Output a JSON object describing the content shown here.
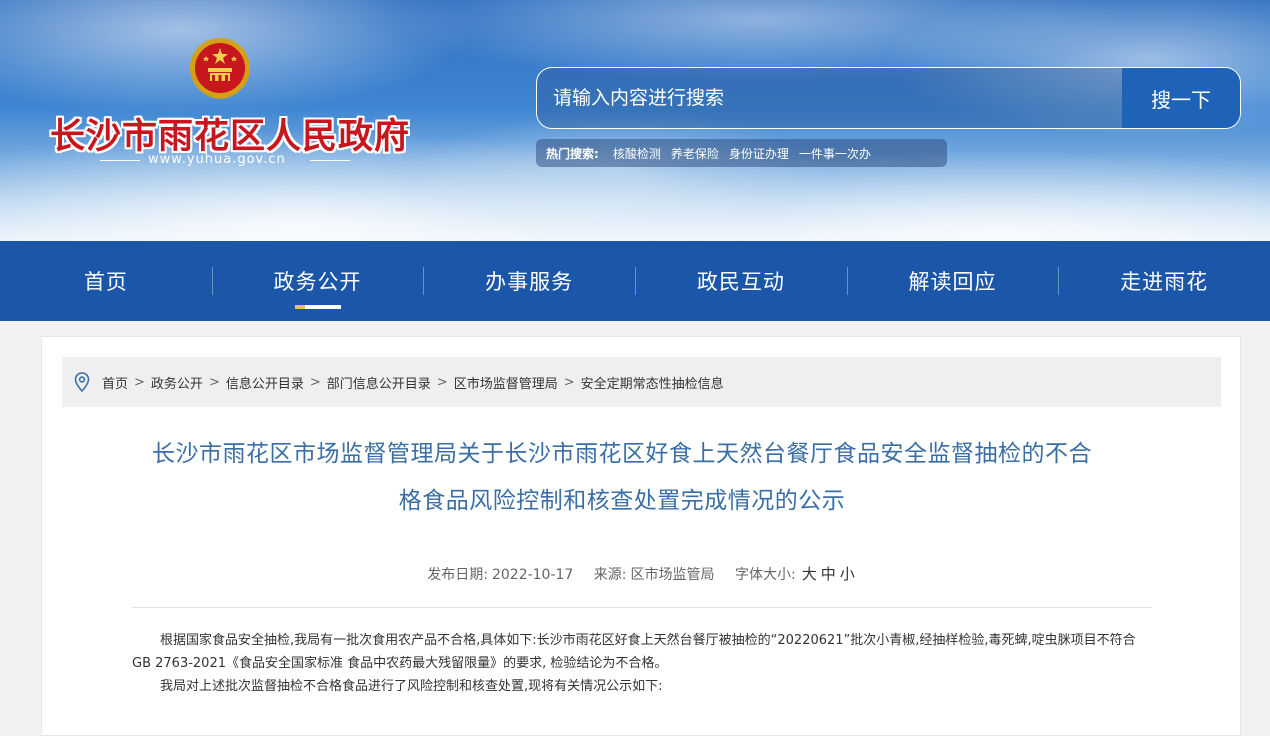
{
  "header": {
    "site_name": "长沙市雨花区人民政府",
    "site_url": "www.yuhua.gov.cn",
    "search": {
      "placeholder": "请输入内容进行搜索",
      "button_label": "搜一下"
    },
    "hot_search": {
      "label": "热门搜索:",
      "links": [
        "核酸检测",
        "养老保险",
        "身份证办理",
        "一件事一次办"
      ]
    }
  },
  "nav": {
    "items": [
      "首页",
      "政务公开",
      "办事服务",
      "政民互动",
      "解读回应",
      "走进雨花"
    ],
    "active": "政务公开"
  },
  "breadcrumb": [
    "首页",
    "政务公开",
    "信息公开目录",
    "部门信息公开目录",
    "区市场监督管理局",
    "安全定期常态性抽检信息"
  ],
  "article": {
    "title_line1": "长沙市雨花区市场监督管理局关于长沙市雨花区好食上天然台餐厅食品安全监督抽检的不合",
    "title_line2": "格食品风险控制和核查处置完成情况的公示",
    "date_label": "发布日期:",
    "date": "2022-10-17",
    "source_label": "来源:",
    "source": "区市场监管局",
    "font_size_label": "字体大小:",
    "font_sizes": [
      "大",
      "中",
      "小"
    ],
    "paragraphs": [
      "根据国家食品安全抽检,我局有一批次食用农产品不合格,具体如下:长沙市雨花区好食上天然台餐厅被抽检的“20220621”批次小青椒,经抽样检验,毒死蜱,啶虫脒项目不符合GB 2763-2021《食品安全国家标准 食品中农药最大残留限量》的要求, 检验结论为不合格。",
      "我局对上述批次监督抽检不合格食品进行了风险控制和核查处置,现将有关情况公示如下:"
    ]
  },
  "colors": {
    "nav_bg": "#1b56a8",
    "site_name": "#c8161e",
    "title": "#3a6ea5",
    "search_button": "#1f63b8"
  }
}
